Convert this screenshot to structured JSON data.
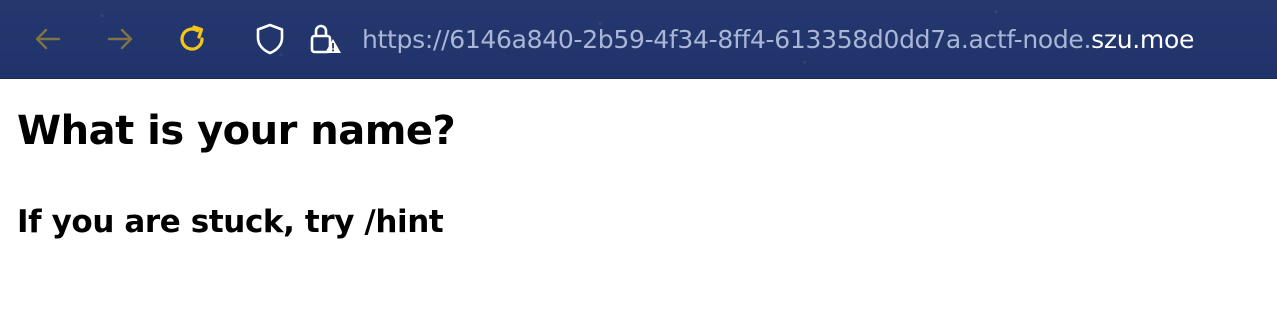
{
  "browser": {
    "icons": {
      "back": "arrow-left-icon",
      "forward": "arrow-right-icon",
      "reload": "reload-icon",
      "tracking": "shield-icon",
      "security": "lock-warning-icon"
    },
    "url": {
      "prefix": "https://6146a840-2b59-4f34-8ff4-613358d0dd7a.actf-node.",
      "host": "szu.moe"
    },
    "colors": {
      "toolbar_bg": "#22356a",
      "nav_disabled": "#8a7a3a",
      "reload": "#f5c518",
      "icon_white": "#ffffff"
    }
  },
  "page": {
    "title": "What is your name?",
    "hint": "If you are stuck, try /hint"
  }
}
